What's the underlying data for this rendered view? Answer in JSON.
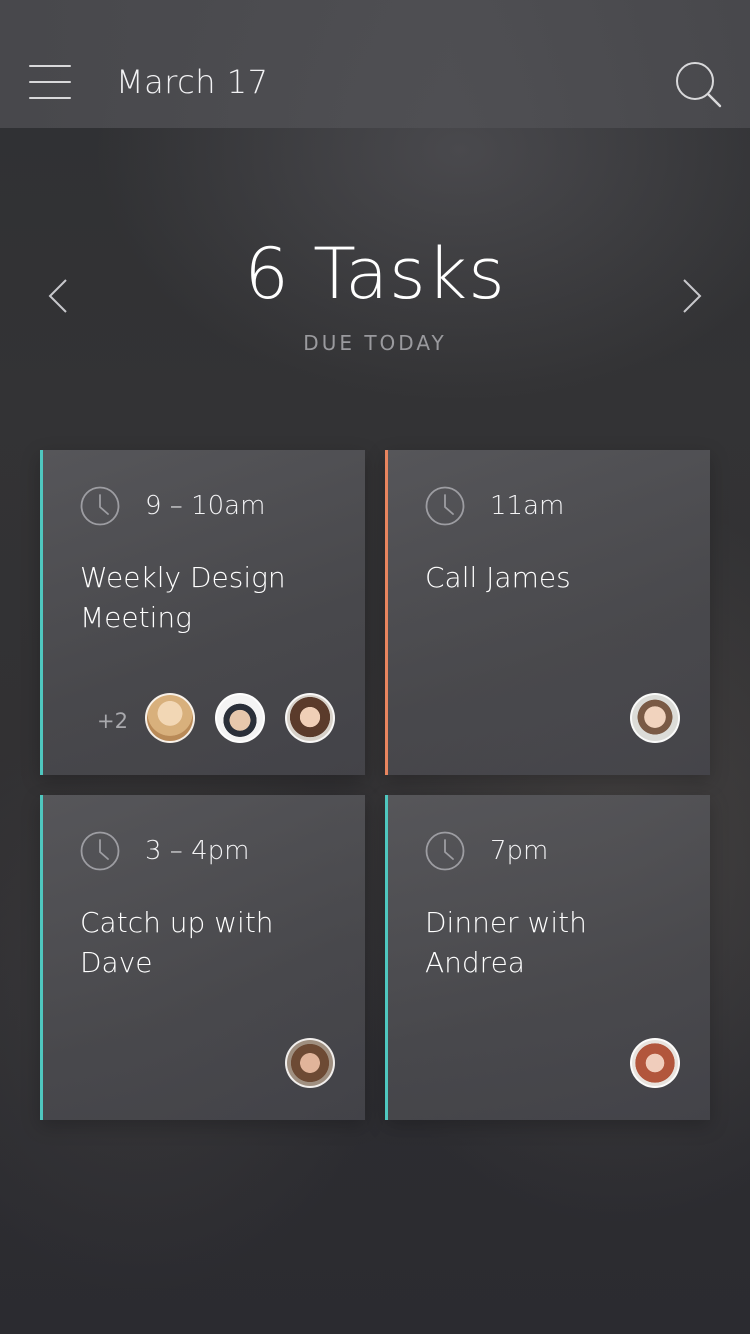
{
  "header": {
    "date": "March 17",
    "menu_icon": "hamburger-menu-icon",
    "search_icon": "search-icon"
  },
  "summary": {
    "count_label": "6 Tasks",
    "subtitle": "DUE TODAY",
    "prev_icon": "chevron-left-icon",
    "next_icon": "chevron-right-icon"
  },
  "cards": [
    {
      "time": "9 – 10am",
      "title": "Weekly Design Meeting",
      "accent": "#4fc7bf",
      "extra_attendees": "+2",
      "attendee_avatars": 3
    },
    {
      "time": "11am",
      "title": "Call James",
      "accent": "#e8855f",
      "attendee_avatars": 1
    },
    {
      "time": "3 – 4pm",
      "title": "Catch up with Dave",
      "accent": "#4fc7bf",
      "attendee_avatars": 1
    },
    {
      "time": "7pm",
      "title": "Dinner with Andrea",
      "accent": "#4fc7bf",
      "attendee_avatars": 1
    }
  ],
  "colors": {
    "teal_accent": "#4fc7bf",
    "orange_accent": "#e8855f",
    "muted_text": "#9a9a9e"
  }
}
